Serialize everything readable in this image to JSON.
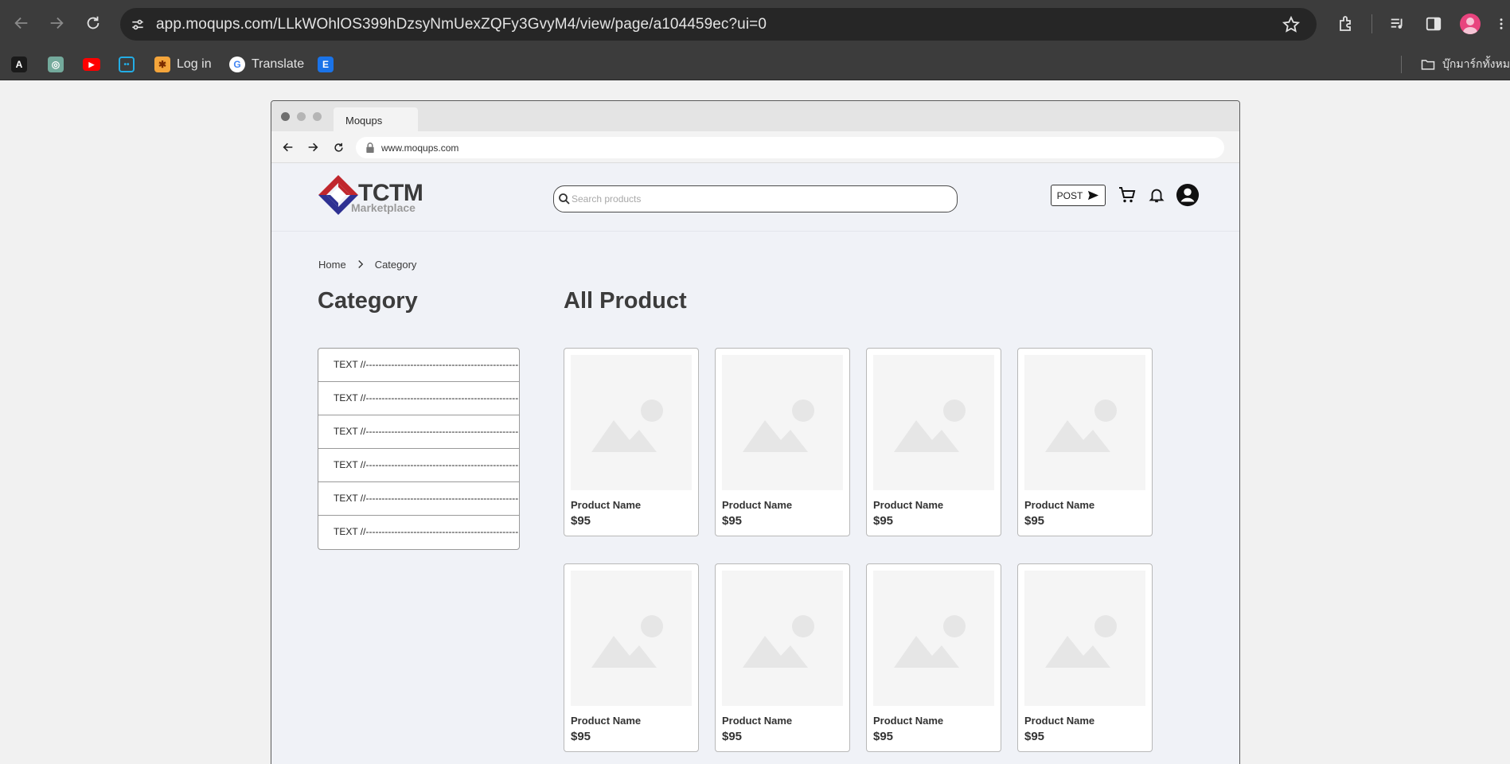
{
  "browser": {
    "url": "app.moqups.com/LLkWOhlOS399hDzsyNmUexZQFy3GvyM4/view/page/a104459ec?ui=0",
    "bookmarks": [
      {
        "label": "",
        "icon": "a-logo-icon"
      },
      {
        "label": "",
        "icon": "chatgpt-icon"
      },
      {
        "label": "",
        "icon": "youtube-icon"
      },
      {
        "label": "",
        "icon": "bilibili-icon"
      },
      {
        "label": "Log in",
        "icon": "login-site-icon"
      },
      {
        "label": "Translate",
        "icon": "google-icon"
      },
      {
        "label": "",
        "icon": "e-site-icon"
      }
    ],
    "bookmark_folder": "บุ๊กมาร์กทั้งหมด"
  },
  "mock_browser": {
    "tab_title": "Moqups",
    "address": "www.moqups.com"
  },
  "site": {
    "logo_word": "TCTM",
    "logo_sub": "Marketplace",
    "search_placeholder": "Search products",
    "post_label": "POST"
  },
  "breadcrumb": [
    "Home",
    "Category"
  ],
  "category_heading": "Category",
  "products_heading": "All Product",
  "categories": [
    "TEXT //------------------------------------------------",
    "TEXT //------------------------------------------------",
    "TEXT //------------------------------------------------",
    "TEXT //------------------------------------------------",
    "TEXT //------------------------------------------------",
    "TEXT //------------------------------------------------"
  ],
  "products": [
    {
      "name": "Product Name",
      "price": "$95"
    },
    {
      "name": "Product Name",
      "price": "$95"
    },
    {
      "name": "Product Name",
      "price": "$95"
    },
    {
      "name": "Product Name",
      "price": "$95"
    },
    {
      "name": "Product Name",
      "price": "$95"
    },
    {
      "name": "Product Name",
      "price": "$95"
    },
    {
      "name": "Product Name",
      "price": "$95"
    },
    {
      "name": "Product Name",
      "price": "$95"
    }
  ],
  "colors": {
    "chrome_bg": "#3c3c3c",
    "page_bg": "#f0f2f7",
    "logo_red": "#c0272d",
    "logo_blue": "#2e3192"
  }
}
